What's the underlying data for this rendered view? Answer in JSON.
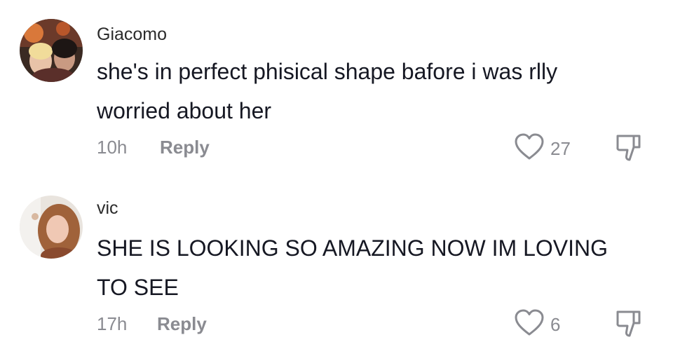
{
  "comments": [
    {
      "username": "Giacomo",
      "text": "she's in perfect phisical shape bafore i was rlly worried about her",
      "time": "10h",
      "reply_label": "Reply",
      "likes": "27"
    },
    {
      "username": "vic",
      "text": "SHE IS LOOKING SO AMAZING NOW IM LOVING TO SEE",
      "time": "17h",
      "reply_label": "Reply",
      "likes": "6"
    }
  ],
  "colors": {
    "text": "#161823",
    "muted": "#8a8b91",
    "background": "#ffffff"
  },
  "icons": {
    "like": "heart-outline-icon",
    "dislike": "thumbs-down-outline-icon"
  }
}
